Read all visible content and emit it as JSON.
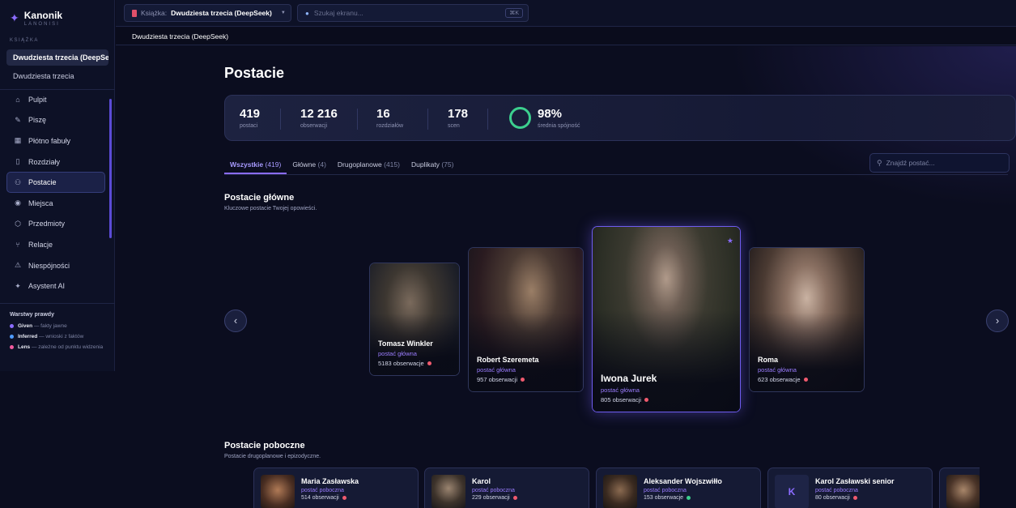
{
  "app": {
    "name": "Kanonik",
    "tagline": "LANONISI"
  },
  "sidebar": {
    "section_label": "KSIĄŻKA",
    "books": [
      "Dwudziesta trzecia (DeepSeek)",
      "Dwudziesta trzecia"
    ],
    "nav": [
      {
        "label": "Pulpit",
        "icon": "home-icon"
      },
      {
        "label": "Piszę",
        "icon": "pencil-icon"
      },
      {
        "label": "Płótno fabuły",
        "icon": "grid-icon"
      },
      {
        "label": "Rozdziały",
        "icon": "book-icon"
      },
      {
        "label": "Postacie",
        "icon": "users-icon",
        "active": true
      },
      {
        "label": "Miejsca",
        "icon": "pin-icon"
      },
      {
        "label": "Przedmioty",
        "icon": "box-icon"
      },
      {
        "label": "Relacje",
        "icon": "graph-icon"
      },
      {
        "label": "Niespójności",
        "icon": "warning-icon"
      },
      {
        "label": "Asystent AI",
        "icon": "sparkle-icon"
      }
    ],
    "legend_title": "Warstwy prawdy",
    "legend": [
      {
        "name": "Given",
        "desc": "— fakty jawne",
        "color": "#8b6cff"
      },
      {
        "name": "Inferred",
        "desc": "— wnioski z faktów",
        "color": "#4f9bff"
      },
      {
        "name": "Lens",
        "desc": "— zależne od punktu widzenia",
        "color": "#f05a9e"
      }
    ]
  },
  "topbar": {
    "book_label": "Książka:",
    "book_value": "Dwudziesta trzecia (DeepSeek)",
    "search_placeholder": "Szukaj ekranu...",
    "shortcut": "⌘K"
  },
  "breadcrumb": "Dwudziesta trzecia (DeepSeek)",
  "page": {
    "title": "Postacie",
    "stats": [
      {
        "value": "419",
        "label": "postaci"
      },
      {
        "value": "12 216",
        "label": "obserwacji"
      },
      {
        "value": "16",
        "label": "rozdziałów"
      },
      {
        "value": "178",
        "label": "scen"
      }
    ],
    "consistency": {
      "value": "98%",
      "label": "średnia spójność",
      "color": "#3ccf8e"
    },
    "tabs": [
      {
        "label": "Wszystkie",
        "count": "(419)",
        "active": true
      },
      {
        "label": "Główne",
        "count": "(4)"
      },
      {
        "label": "Drugoplanowe",
        "count": "(415)"
      },
      {
        "label": "Duplikaty",
        "count": "(75)"
      }
    ],
    "char_search_placeholder": "Znajdź postać..."
  },
  "main_section": {
    "title": "Postacie główne",
    "subtitle": "Kluczowe postacie Twojej opowieści.",
    "cards": [
      {
        "name": "Tomasz Winkler",
        "role": "postać główna",
        "obs": "5183 obserwacje"
      },
      {
        "name": "Robert Szeremeta",
        "role": "postać główna",
        "obs": "957 obserwacji"
      },
      {
        "name": "Iwona Jurek",
        "role": "postać główna",
        "obs": "805 obserwacji"
      },
      {
        "name": "Roma",
        "role": "postać główna",
        "obs": "623 obserwacje"
      }
    ]
  },
  "side_section": {
    "title": "Postacie poboczne",
    "subtitle": "Postacie drugoplanowe i epizodyczne.",
    "cards": [
      {
        "name": "Maria Zasławska",
        "role": "postać poboczna",
        "obs": "514 obserwacji",
        "dot": "red"
      },
      {
        "name": "Karol",
        "role": "postać poboczna",
        "obs": "229 obserwacji",
        "dot": "red"
      },
      {
        "name": "Aleksander Wojszwiłło",
        "role": "postać poboczna",
        "obs": "153 obserwacje",
        "dot": "green"
      },
      {
        "name": "Karol Zasławski senior",
        "role": "postać poboczna",
        "obs": "80 obserwacji",
        "dot": "green",
        "initial": "K"
      }
    ]
  }
}
